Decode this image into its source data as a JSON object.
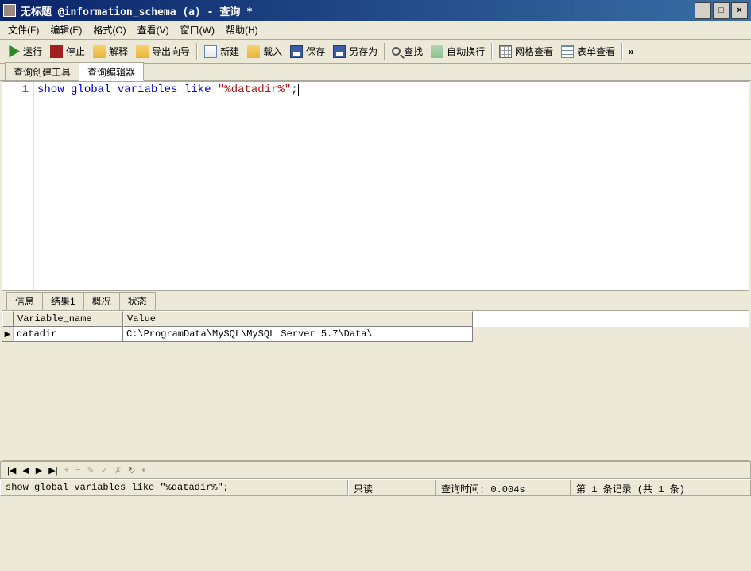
{
  "window": {
    "title": "无标题 @information_schema (a) - 查询 *"
  },
  "menu": {
    "file": "文件(F)",
    "edit": "编辑(E)",
    "format": "格式(O)",
    "view": "查看(V)",
    "window": "窗口(W)",
    "help": "帮助(H)"
  },
  "toolbar": {
    "run": "运行",
    "stop": "停止",
    "explain": "解释",
    "export_wizard": "导出向导",
    "new": "新建",
    "load": "载入",
    "save": "保存",
    "save_as": "另存为",
    "find": "查找",
    "autowrap": "自动换行",
    "grid_view": "网格查看",
    "form_view": "表单查看",
    "overflow": "»"
  },
  "upper_tabs": {
    "builder": "查询创建工具",
    "editor": "查询编辑器"
  },
  "editor": {
    "line_no": "1",
    "tok_show": "show",
    "tok_global": "global",
    "tok_variables": "variables",
    "tok_like": "like",
    "tok_str": "\"%datadir%\"",
    "tok_semi": ";"
  },
  "lower_tabs": {
    "info": "信息",
    "result": "结果1",
    "profile": "概况",
    "status": "状态"
  },
  "grid": {
    "col_variable": "Variable_name",
    "col_value": "Value",
    "row_indicator": "▶",
    "rows": [
      {
        "variable": "datadir",
        "value": "C:\\ProgramData\\MySQL\\MySQL Server 5.7\\Data\\"
      }
    ]
  },
  "nav": {
    "first": "|◀",
    "prev": "◀",
    "next": "▶",
    "last": "▶|",
    "plus": "+",
    "minus": "−",
    "edit": "✎",
    "check": "✓",
    "cancel": "✗",
    "refresh": "↻",
    "help": "◐"
  },
  "status": {
    "sql": "show global variables like \"%datadir%\";",
    "readonly": "只读",
    "qtime": "查询时间: 0.004s",
    "rec": "第 1 条记录 (共 1 条)"
  }
}
